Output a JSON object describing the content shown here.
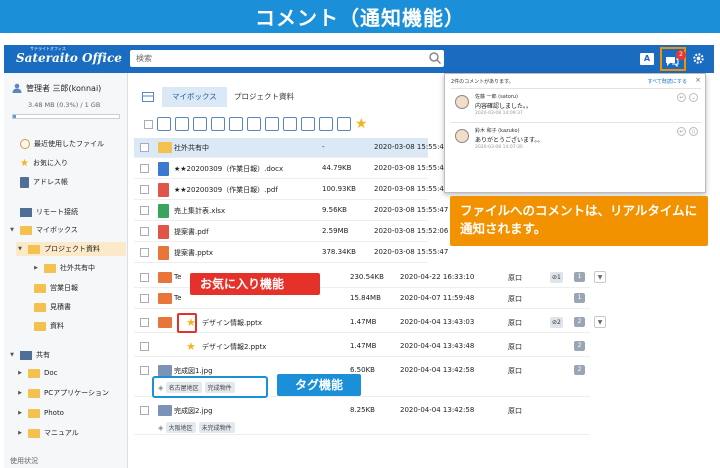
{
  "banner": {
    "title": "コメント（通知機能）"
  },
  "app": {
    "logo": "Sateraito Office",
    "logo_sub": "サテライトオフィス",
    "search_placeholder": "検索",
    "a_icon_label": "A",
    "notification_count": "2",
    "colors": {
      "appbar": "#1a6cc1",
      "banner": "#1b8fd8",
      "highlight_orange": "#f39200",
      "highlight_red": "#e4322b"
    }
  },
  "sidebar": {
    "user": "管理者 三郎(konnai)",
    "quota": "3.48 MB (0.3%) / 1 GB",
    "quota_fraction": 0.003,
    "items": [
      {
        "label": "最近使用したファイル",
        "icon": "clock-icon"
      },
      {
        "label": "お気に入り",
        "icon": "star-icon"
      },
      {
        "label": "アドレス帳",
        "icon": "address-book-icon"
      },
      {
        "label": "リモート接続",
        "icon": "monitor-icon"
      },
      {
        "label": "マイボックス",
        "icon": "folder-icon"
      },
      {
        "label": "プロジェクト資料",
        "icon": "folder-icon"
      },
      {
        "label": "社外共有中",
        "icon": "folder-icon"
      },
      {
        "label": "営業日報",
        "icon": "folder-icon"
      },
      {
        "label": "見積書",
        "icon": "folder-icon"
      },
      {
        "label": "資料",
        "icon": "folder-icon"
      },
      {
        "label": "共有",
        "icon": "monitor-icon"
      },
      {
        "label": "Doc",
        "icon": "folder-icon"
      },
      {
        "label": "PCアプリケーション",
        "icon": "folder-icon"
      },
      {
        "label": "Photo",
        "icon": "folder-icon"
      },
      {
        "label": "マニュアル",
        "icon": "folder-icon"
      },
      {
        "label": "使用状況",
        "icon": ""
      }
    ]
  },
  "main": {
    "tabs": [
      "マイボックス",
      "プロジェクト資料"
    ],
    "files": [
      {
        "name": "社外共有中",
        "size": "-",
        "date": "2020-03-08 15:55:47",
        "type": "folder"
      },
      {
        "name": "★★20200309（作業日報）.docx",
        "size": "44.79KB",
        "date": "2020-03-08 15:55:47",
        "type": "docx"
      },
      {
        "name": "★★20200309（作業日報）.pdf",
        "size": "100.93KB",
        "date": "2020-03-08 15:55:47",
        "type": "pdf"
      },
      {
        "name": "売上集計表.xlsx",
        "size": "9.56KB",
        "date": "2020-03-08 15:55:47",
        "type": "xlsx"
      },
      {
        "name": "提案書.pdf",
        "size": "2.59MB",
        "date": "2020-03-08 15:52:06",
        "type": "pdf"
      },
      {
        "name": "提案書.pptx",
        "size": "378.34KB",
        "date": "2020-03-08 15:55:47",
        "type": "pptx"
      }
    ],
    "files2": [
      {
        "name": "Te",
        "size": "230.54KB",
        "date": "2020-04-22 16:33:10",
        "owner": "原口",
        "type": "pptx",
        "links": "1",
        "comments": "1"
      },
      {
        "name": "Te",
        "size": "15.84MB",
        "date": "2020-04-07 11:59:48",
        "owner": "原口",
        "type": "pptx",
        "links": "",
        "comments": "1"
      },
      {
        "name": "デザイン情報.pptx",
        "size": "1.47MB",
        "date": "2020-04-04 13:43:03",
        "owner": "原口",
        "type": "pptx",
        "links": "2",
        "comments": "2"
      },
      {
        "name": "デザイン情報2.pptx",
        "size": "1.47MB",
        "date": "2020-04-04 13:43:48",
        "owner": "原口",
        "type": "pptx",
        "links": "",
        "comments": "2"
      },
      {
        "name": "完成図1.jpg",
        "size": "6.50KB",
        "date": "2020-04-04 13:42:58",
        "owner": "原口",
        "type": "jpg",
        "links": "",
        "comments": "2",
        "tags": [
          "名古屋地区",
          "完成物件"
        ]
      },
      {
        "name": "完成図2.jpg",
        "size": "8.25KB",
        "date": "2020-04-04 13:42:58",
        "owner": "原口",
        "type": "jpg",
        "links": "",
        "comments": "",
        "tags": [
          "大阪地区",
          "未完成物件"
        ]
      }
    ]
  },
  "popup": {
    "header": "2件のコメントがあります。",
    "view_all": "すべて既読にする",
    "comments": [
      {
        "name": "佐藤 一郎 (satoru)",
        "text": "内容確認しました。。",
        "time": "2020-03-08 14:09:37"
      },
      {
        "name": "鈴木 和子 (kazuko)",
        "text": "ありがとうございます。。",
        "time": "2020-03-08 14:07:30"
      }
    ]
  },
  "callouts": {
    "notify": "ファイルへのコメントは、リアルタイムに通知されます。",
    "favorite": "お気に入り機能",
    "tag": "タグ機能"
  }
}
